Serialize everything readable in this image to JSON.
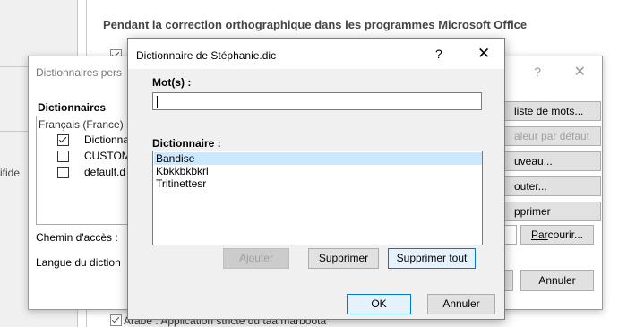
{
  "background": {
    "heading": "Pendant la correction orthographique dans les programmes Microsoft Office",
    "bottom_option": "Arabe : Application stricte du taa marboota",
    "side_text": "ifide"
  },
  "mid_dialog": {
    "title": "Dictionnaires pers",
    "help": "?",
    "close": "✕",
    "dicts_label": "Dictionnaires",
    "lang_group": "Français (France)",
    "items": [
      {
        "label": "Dictionna",
        "checked": true
      },
      {
        "label": "CUSTOM.",
        "checked": false
      },
      {
        "label": "default.d",
        "checked": false
      }
    ],
    "path_label": "Chemin d'accès :",
    "lang_label": "Langue du diction",
    "buttons": {
      "edit_list": "liste de mots...",
      "default": "aleur par défaut",
      "new": "uveau...",
      "add": "outer...",
      "remove": "pprimer",
      "browse": "Parcourir...",
      "cancel": "Annuler"
    }
  },
  "front_dialog": {
    "title": "Dictionnaire de Stéphanie.dic",
    "help": "?",
    "close": "✕",
    "words_label": "Mot(s) :",
    "words_value": "",
    "dict_label": "Dictionnaire :",
    "entries": [
      "Bandise",
      "Kbkkbkbkrl",
      "Tritinettesr"
    ],
    "selected_index": 0,
    "buttons": {
      "add": "Ajouter",
      "delete": "Supprimer",
      "delete_all": "Supprimer tout",
      "ok": "OK",
      "cancel": "Annuler"
    }
  }
}
